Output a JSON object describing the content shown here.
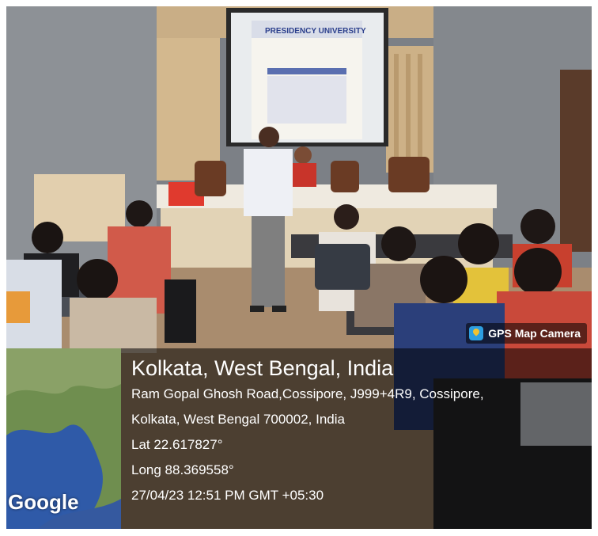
{
  "photo": {
    "projector_slide_title": "PRESIDENCY UNIVERSITY"
  },
  "badge": {
    "label": "GPS Map Camera",
    "icon": "gps-map-camera-icon"
  },
  "map": {
    "watermark": "Google"
  },
  "location": {
    "title": "Kolkata, West Bengal, India",
    "address_line1": "Ram Gopal Ghosh Road,Cossipore, J999+4R9, Cossipore,",
    "address_line2": "Kolkata, West Bengal 700002, India",
    "lat": "Lat 22.617827°",
    "long": "Long 88.369558°",
    "datetime": "27/04/23 12:51 PM GMT +05:30"
  }
}
